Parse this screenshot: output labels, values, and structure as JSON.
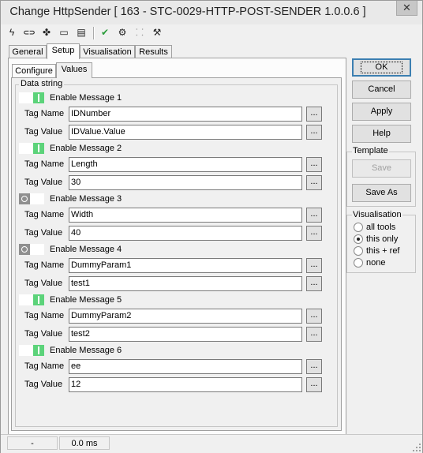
{
  "window": {
    "title": "Change HttpSender [ 163 - STC-0029-HTTP-POST-SENDER 1.0.0.6 ]",
    "close_label": "✕"
  },
  "toolbar": {
    "icons": [
      "lightning-icon",
      "link-icon",
      "puzzle-icon",
      "console-icon",
      "list-icon",
      "checkmark-icon",
      "run-icon",
      "tree-icon",
      "wrench-icon"
    ],
    "glyphs": [
      "ϟ",
      "⊂⊃",
      "✤",
      "▭",
      "▤",
      "✔",
      "⚙",
      "⸬",
      "⚒"
    ]
  },
  "main_tabs": [
    "General",
    "Setup",
    "Visualisation",
    "Results"
  ],
  "sub_tabs": [
    "Configure",
    "Values"
  ],
  "group_title": "Data string",
  "labels": {
    "tag_name": "Tag Name",
    "tag_value": "Tag Value",
    "browse": "..."
  },
  "messages": [
    {
      "label": "Enable Message 1",
      "enabled": true,
      "tag_name": "IDNumber",
      "tag_value": "IDValue.Value"
    },
    {
      "label": "Enable Message 2",
      "enabled": true,
      "tag_name": "Length",
      "tag_value": "30"
    },
    {
      "label": "Enable Message 3",
      "enabled": false,
      "tag_name": "Width",
      "tag_value": "40"
    },
    {
      "label": "Enable Message 4",
      "enabled": false,
      "tag_name": "DummyParam1",
      "tag_value": "test1"
    },
    {
      "label": "Enable Message 5",
      "enabled": true,
      "tag_name": "DummyParam2",
      "tag_value": "test2"
    },
    {
      "label": "Enable Message 6",
      "enabled": true,
      "tag_name": "ee",
      "tag_value": "12"
    }
  ],
  "buttons": {
    "ok": "OK",
    "cancel": "Cancel",
    "apply": "Apply",
    "help": "Help"
  },
  "template": {
    "title": "Template",
    "save": "Save",
    "save_as": "Save As"
  },
  "visualisation": {
    "title": "Visualisation",
    "options": [
      "all tools",
      "this only",
      "this + ref",
      "none"
    ],
    "selected": "this only"
  },
  "status": {
    "cell1": "-",
    "cell2": "0.0 ms"
  },
  "colors": {
    "toggle_on": "#5cd37a",
    "toggle_off": "#8f8f8f",
    "default_button_border": "#3c7fb1"
  }
}
